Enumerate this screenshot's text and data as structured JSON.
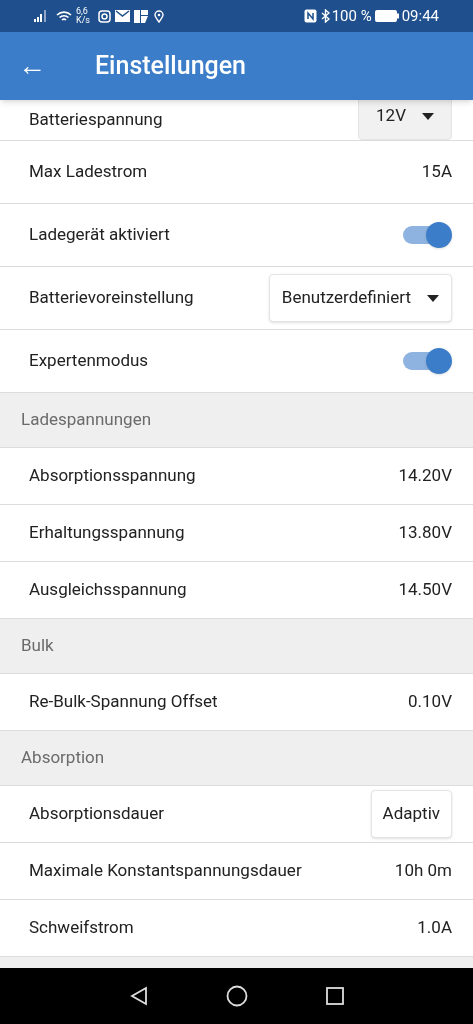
{
  "status_bar": {
    "net_speed": "6,6",
    "net_unit": "K/s",
    "battery": "100 %",
    "time": "09:44"
  },
  "app_bar": {
    "back": "←",
    "title": "Einstellungen"
  },
  "items": [
    {
      "kind": "dropdown-filled",
      "label": "Batteriespannung",
      "value": "12V"
    },
    {
      "kind": "value",
      "label": "Max Ladestrom",
      "value": "15A"
    },
    {
      "kind": "toggle",
      "label": "Ladegerät aktiviert",
      "on": true
    },
    {
      "kind": "dropdown",
      "label": "Batterievoreinstellung",
      "value": "Benutzerdefiniert"
    },
    {
      "kind": "toggle",
      "label": "Expertenmodus",
      "on": true
    },
    {
      "kind": "header",
      "label": "Ladespannungen"
    },
    {
      "kind": "value",
      "label": "Absorptionsspannung",
      "value": "14.20V"
    },
    {
      "kind": "value",
      "label": "Erhaltungsspannung",
      "value": "13.80V"
    },
    {
      "kind": "value",
      "label": "Ausgleichsspannung",
      "value": "14.50V"
    },
    {
      "kind": "header",
      "label": "Bulk"
    },
    {
      "kind": "value",
      "label": "Re-Bulk-Spannung Offset",
      "value": "0.10V"
    },
    {
      "kind": "header",
      "label": "Absorption"
    },
    {
      "kind": "button",
      "label": "Absorptionsdauer",
      "value": "Adaptiv"
    },
    {
      "kind": "value",
      "label": "Maximale Konstantspannungsdauer",
      "value": "10h 0m"
    },
    {
      "kind": "value",
      "label": "Schweifstrom",
      "value": "1.0A"
    }
  ]
}
